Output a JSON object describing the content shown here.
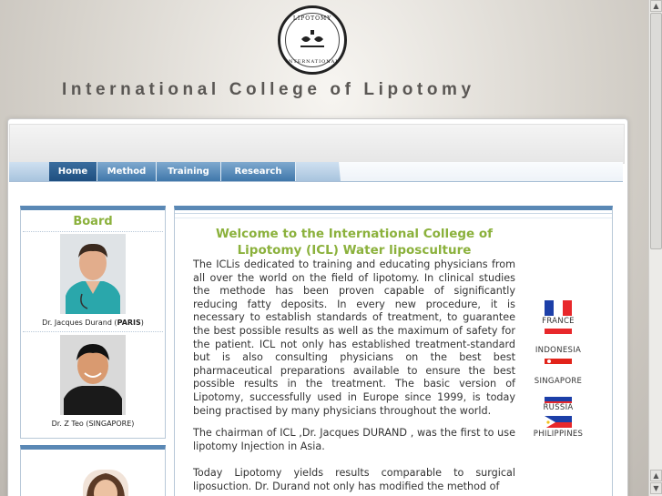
{
  "logo": {
    "ring_top": "LIPOTOMY",
    "ring_bottom": "INTERNATIONAL"
  },
  "site_title": "International College of Lipotomy",
  "nav": {
    "tabs": [
      "Home",
      "Method",
      "Training",
      "Research"
    ],
    "active": "Home"
  },
  "sidebar": {
    "title": "Board",
    "members": [
      {
        "name": "Dr. Jacques Durand  (",
        "location": "PARIS",
        "close": ")"
      },
      {
        "name": "Dr. Z Teo (SINGAPORE)"
      }
    ]
  },
  "main": {
    "welcome": "Welcome to the International College of Lipotomy (ICL) Water liposculture",
    "paragraph1": "The ICLis dedicated to training and educating physicians from all over the world on the field of lipotomy. In clinical studies the methode has been proven capable of significantly reducing fatty deposits. In every new procedure, it is necessary to establish standards of treatment, to guarantee the best possible results as well as the maximum of safety for the patient. ICL not only has established treatment-standard but is also consulting physicians on the best best pharmaceutical preparations available to ensure the best possible results in the treatment. The basic version of Lipotomy, successfully used in Europe since 1999, is today being practised by many physicians throughout the world.",
    "paragraph2": "The chairman of ICL ,Dr. Jacques DURAND , was the first to use lipotomy Injection in Asia.",
    "paragraph3": "Today Lipotomy yields results comparable to surgical liposuction. Dr. Durand not only has modified the method of"
  },
  "countries": [
    "FRANCE",
    "INDONESIA",
    "SINGAPORE",
    "RUSSIA",
    "PHILIPPINES"
  ],
  "colors": {
    "accent_green": "#8bb13c",
    "nav_blue": "#3f77aa",
    "nav_active": "#1f4f80"
  }
}
